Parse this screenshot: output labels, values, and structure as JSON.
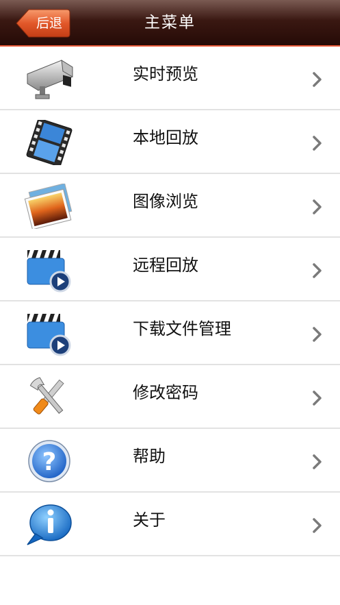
{
  "header": {
    "back_label": "后退",
    "title": "主菜单"
  },
  "menu": {
    "items": [
      {
        "label": "实时预览",
        "icon": "cctv-camera-icon"
      },
      {
        "label": "本地回放",
        "icon": "film-strip-icon"
      },
      {
        "label": "图像浏览",
        "icon": "photo-icon"
      },
      {
        "label": "远程回放",
        "icon": "video-clapper-play-icon"
      },
      {
        "label": "下载文件管理",
        "icon": "video-clapper-play-icon"
      },
      {
        "label": "修改密码",
        "icon": "tools-icon"
      },
      {
        "label": "帮助",
        "icon": "help-icon"
      },
      {
        "label": "关于",
        "icon": "info-bubble-icon"
      }
    ]
  },
  "colors": {
    "navbar": "#3a1812",
    "back_button": "#e05a2c",
    "accent_line": "#e85a3a"
  }
}
